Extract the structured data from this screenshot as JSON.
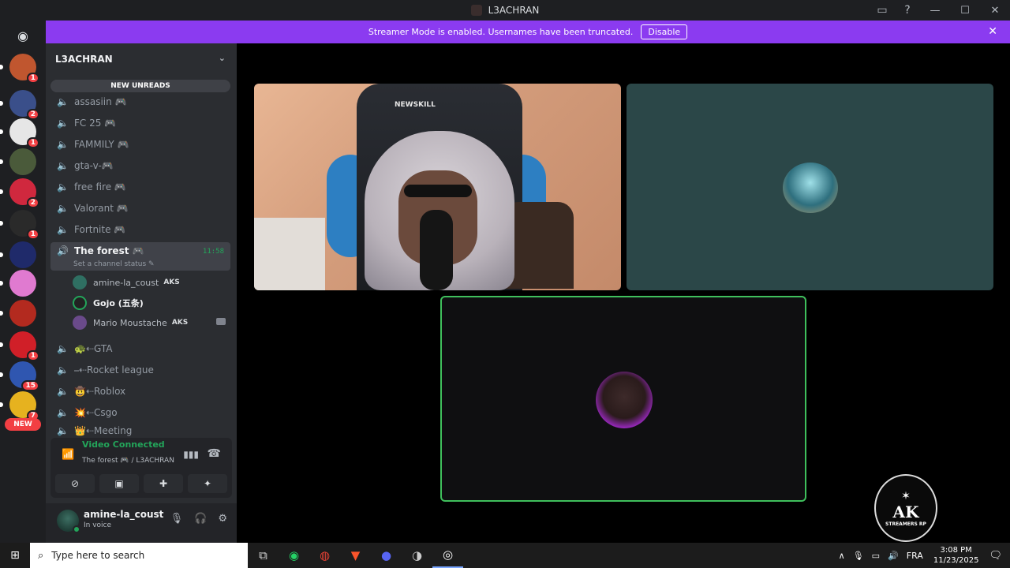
{
  "window": {
    "title": "L3ACHRAN"
  },
  "streamer_bar": {
    "message": "Streamer Mode is enabled. Usernames have been truncated.",
    "disable_label": "Disable"
  },
  "rail": {
    "badges": [
      "1",
      "2",
      "1",
      "2",
      "1",
      "1",
      "15",
      "7"
    ],
    "new_label": "NEW"
  },
  "guild": {
    "name": "L3ACHRAN",
    "new_unreads_label": "NEW UNREADS"
  },
  "channels": [
    {
      "name": "assasiin 🎮"
    },
    {
      "name": "FC 25 🎮"
    },
    {
      "name": "FAMMILY 🎮"
    },
    {
      "name": "gta-v-🎮"
    },
    {
      "name": "free fire 🎮"
    },
    {
      "name": "Valorant 🎮"
    },
    {
      "name": "Fortnite 🎮"
    }
  ],
  "active_channel": {
    "name": "The forest 🎮",
    "time": "11:58",
    "status": "Set a channel status ✎"
  },
  "voice_users": [
    {
      "name": "amine-la_coust",
      "tag": "AKS"
    },
    {
      "name": "Gojo (五条)",
      "tag": ""
    },
    {
      "name": "Mario Moustache",
      "tag": "AKS"
    }
  ],
  "more_channels": [
    {
      "name": "🐢⇠GTA"
    },
    {
      "name": "⎯⇠Rocket league"
    },
    {
      "name": "🤠⇠Roblox"
    },
    {
      "name": "💥⇠Csgo"
    },
    {
      "name": "👑⇠Meeting"
    }
  ],
  "voice_panel": {
    "status": "Video Connected",
    "channel": "The forest 🎮 / L3ACHRAN"
  },
  "user_panel": {
    "name": "amine-la_coust",
    "status": "In voice"
  },
  "stage": {
    "chair_logo": "NEWSKILL",
    "badge_main": "AK",
    "badge_sub": "STREAMERS RP"
  },
  "taskbar": {
    "search_placeholder": "Type here to search",
    "language": "FRA",
    "time": "3:08 PM",
    "date": "11/23/2025"
  }
}
